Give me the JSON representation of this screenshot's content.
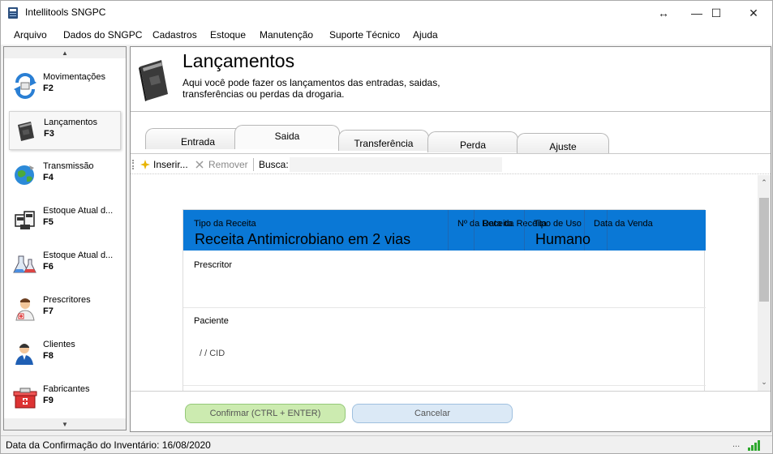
{
  "window": {
    "title": "Intellitools SNGPC",
    "controls": {
      "restore_glyph": "↔",
      "minimize_glyph": "—",
      "maximize_glyph": "☐",
      "close_glyph": "✕"
    }
  },
  "menu": [
    "Arquivo",
    "Dados do SNGPC",
    "Cadastros",
    "Estoque",
    "Manutenção",
    "Suporte Técnico",
    "Ajuda"
  ],
  "sidebar": {
    "scroll_up": "▲",
    "scroll_down": "▼",
    "items": [
      {
        "label": "Movimentações",
        "key": "F2",
        "icon": "movimentacoes-icon"
      },
      {
        "label": "Lançamentos",
        "key": "F3",
        "icon": "book-icon",
        "selected": true
      },
      {
        "label": "Transmissão",
        "key": "F4",
        "icon": "globe-icon"
      },
      {
        "label": "Estoque Atual d...",
        "key": "F5",
        "icon": "boxes-icon"
      },
      {
        "label": "Estoque Atual d...",
        "key": "F6",
        "icon": "flask-icon"
      },
      {
        "label": "Prescritores",
        "key": "F7",
        "icon": "doctor-icon"
      },
      {
        "label": "Clientes",
        "key": "F8",
        "icon": "client-icon"
      },
      {
        "label": "Fabricantes",
        "key": "F9",
        "icon": "factory-icon"
      }
    ]
  },
  "header": {
    "title": "Lançamentos",
    "description": "Aqui você pode fazer os lançamentos das entradas, saidas, transferências ou perdas da drogaria."
  },
  "tabs": [
    {
      "label": "Entrada"
    },
    {
      "label": "Saida",
      "active": true
    },
    {
      "label": "Transferência"
    },
    {
      "label": "Perda"
    },
    {
      "label": "Ajuste"
    }
  ],
  "toolbar": {
    "insert_label": "Inserir...",
    "remove_label": "Remover",
    "search_label": "Busca:"
  },
  "card": {
    "columns": {
      "tipo_receita": "Tipo da Receita",
      "numero": "Nº da Receita",
      "data_receita": "Data da Receita",
      "tipo_uso": "Tipo de Uso",
      "data_venda": "Data da Venda"
    },
    "values": {
      "tipo_receita": "Receita Antimicrobiano em 2 vias",
      "tipo_uso": "Humano"
    },
    "header_color": "#0a78d6",
    "prescritor_label": "Prescritor",
    "paciente_label": "Paciente",
    "paciente_placeholder": "/ / CID"
  },
  "buttons": {
    "confirm": "Confirmar (CTRL + ENTER)",
    "cancel": "Cancelar"
  },
  "status": {
    "text": "Data da Confirmação do Inventário: 16/08/2020",
    "dots": "..."
  }
}
